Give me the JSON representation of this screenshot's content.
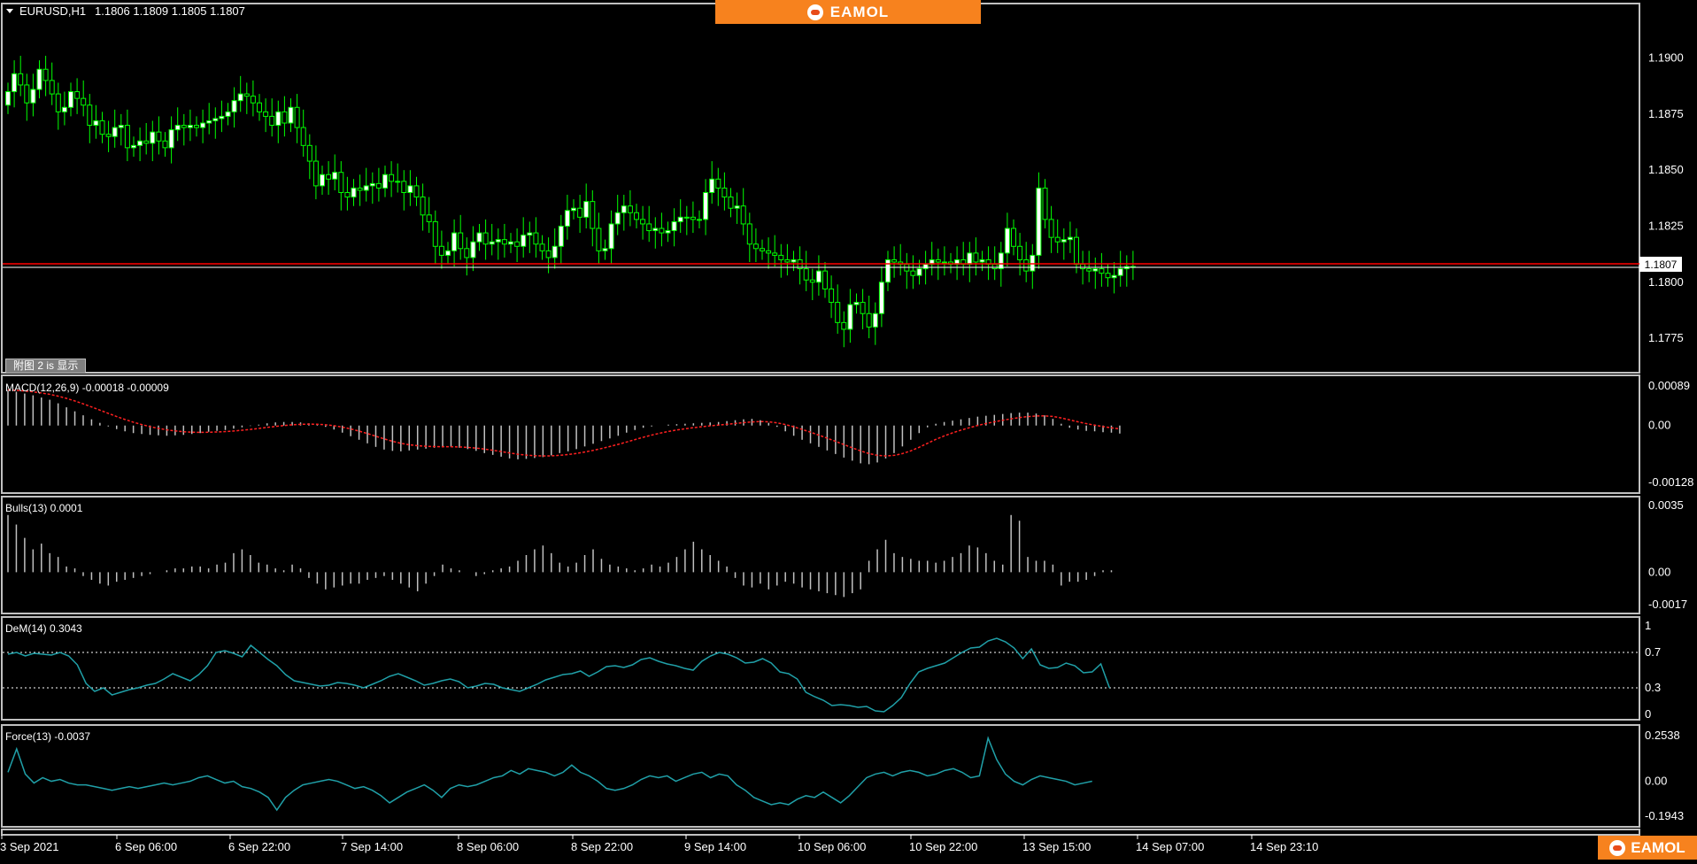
{
  "window": {
    "symbol_timeframe": "EURUSD,H1",
    "ohlc": "1.1806 1.1809 1.1805 1.1807",
    "current_price": "1.1807",
    "subwindow_tag": "附图 2 is 显示",
    "brand": "EAMOL"
  },
  "colors": {
    "background": "#000000",
    "grid_border": "#c0c0c0",
    "bull_candle": "#ffffff",
    "bear_candle": "#000000",
    "wick": "#00ff00",
    "ask_line": "#ff0000",
    "bid_line": "#ffffff",
    "macd_signal": "#ff2020",
    "indicator_line": "#20a0a8",
    "histogram": "#c0c0c0",
    "brand_orange": "#f7821e"
  },
  "panes": {
    "main": {
      "price_ticks": [
        "1.1900",
        "1.1875",
        "1.1850",
        "1.1825",
        "1.1800",
        "1.1775"
      ]
    },
    "macd": {
      "label": "MACD(12,26,9) -0.00018 -0.00009",
      "ticks": [
        "0.00089",
        "0.00",
        "-0.00128"
      ]
    },
    "bulls": {
      "label": "Bulls(13) 0.0001",
      "ticks": [
        "0.0035",
        "0.00",
        "-0.0017"
      ]
    },
    "dem": {
      "label": "DeM(14) 0.3043",
      "ticks": [
        "1",
        "0.7",
        "0.3",
        "0"
      ]
    },
    "force": {
      "label": "Force(13) -0.0037",
      "ticks": [
        "0.2538",
        "0.00",
        "-0.1943"
      ]
    }
  },
  "time_axis": [
    "3 Sep 2021",
    "6 Sep 06:00",
    "6 Sep 22:00",
    "7 Sep 14:00",
    "8 Sep 06:00",
    "8 Sep 22:00",
    "9 Sep 14:00",
    "10 Sep 06:00",
    "10 Sep 22:00",
    "13 Sep 15:00",
    "14 Sep 07:00",
    "14 Sep 23:10"
  ],
  "chart_data": [
    {
      "type": "candlestick",
      "title": "EURUSD,H1",
      "ylim": [
        1.1762,
        1.1918
      ],
      "close": [
        1.1885,
        1.1893,
        1.1888,
        1.188,
        1.1886,
        1.1895,
        1.189,
        1.1884,
        1.1876,
        1.1878,
        1.1885,
        1.1882,
        1.1879,
        1.187,
        1.1872,
        1.1866,
        1.1865,
        1.1869,
        1.187,
        1.186,
        1.1861,
        1.1863,
        1.1862,
        1.1867,
        1.1863,
        1.186,
        1.1868,
        1.187,
        1.1869,
        1.187,
        1.1869,
        1.1871,
        1.1872,
        1.1873,
        1.1874,
        1.1876,
        1.1881,
        1.1884,
        1.1883,
        1.188,
        1.1876,
        1.1874,
        1.187,
        1.1876,
        1.1871,
        1.1878,
        1.1869,
        1.1861,
        1.1854,
        1.1843,
        1.1848,
        1.1846,
        1.1849,
        1.184,
        1.1838,
        1.1842,
        1.1841,
        1.1843,
        1.1844,
        1.1842,
        1.1848,
        1.1845,
        1.1845,
        1.184,
        1.1843,
        1.1838,
        1.183,
        1.1827,
        1.1816,
        1.1812,
        1.1814,
        1.1822,
        1.1815,
        1.1811,
        1.1818,
        1.1822,
        1.1817,
        1.1818,
        1.1819,
        1.1817,
        1.1818,
        1.1816,
        1.1821,
        1.1822,
        1.1817,
        1.1814,
        1.1811,
        1.1816,
        1.1825,
        1.1832,
        1.1833,
        1.1829,
        1.1836,
        1.1824,
        1.1814,
        1.1815,
        1.1826,
        1.1831,
        1.1834,
        1.1831,
        1.1828,
        1.1826,
        1.1823,
        1.1824,
        1.1822,
        1.1823,
        1.1827,
        1.1829,
        1.1829,
        1.1828,
        1.1828,
        1.184,
        1.1846,
        1.1842,
        1.1838,
        1.1833,
        1.1834,
        1.1826,
        1.1817,
        1.1815,
        1.1814,
        1.1813,
        1.1812,
        1.181,
        1.1809,
        1.181,
        1.1806,
        1.1801,
        1.18,
        1.1805,
        1.1797,
        1.1791,
        1.1782,
        1.1779,
        1.179,
        1.1791,
        1.1786,
        1.178,
        1.1786,
        1.18,
        1.181,
        1.1809,
        1.1808,
        1.1805,
        1.1803,
        1.1806,
        1.1808,
        1.181,
        1.1809,
        1.1809,
        1.1808,
        1.181,
        1.1808,
        1.1813,
        1.1809,
        1.181,
        1.1808,
        1.1806,
        1.1813,
        1.1824,
        1.1816,
        1.181,
        1.1805,
        1.1812,
        1.1842,
        1.1828,
        1.182,
        1.1818,
        1.1819,
        1.182,
        1.1808,
        1.1806,
        1.1805,
        1.1806,
        1.1804,
        1.1802,
        1.1803,
        1.1806,
        1.1807,
        1.1807
      ]
    },
    {
      "type": "bar",
      "title": "MACD(12,26,9) -0.00018 -0.00009",
      "ylim": [
        -0.00128,
        0.00089
      ],
      "values": [
        0.0008,
        0.00076,
        0.00072,
        0.00068,
        0.00063,
        0.00058,
        0.0005,
        0.00041,
        0.00032,
        0.00023,
        0.00014,
        6e-05,
        -2e-05,
        -8e-05,
        -0.00013,
        -0.00017,
        -0.00019,
        -0.00021,
        -0.00022,
        -0.00023,
        -0.00022,
        -0.00021,
        -0.00019,
        -0.00017,
        -0.00014,
        -0.00012,
        -0.0001,
        -7e-05,
        -4e-05,
        -1e-05,
        2e-05,
        5e-05,
        7e-05,
        8e-05,
        8e-05,
        7e-05,
        5e-05,
        2e-05,
        -3e-05,
        -9e-05,
        -0.00016,
        -0.00024,
        -0.00032,
        -0.0004,
        -0.00048,
        -0.00054,
        -0.00057,
        -0.00058,
        -0.00056,
        -0.00054,
        -0.00052,
        -0.0005,
        -0.00049,
        -0.00048,
        -0.0005,
        -0.00053,
        -0.00057,
        -0.00062,
        -0.00066,
        -0.0007,
        -0.00074,
        -0.00076,
        -0.00075,
        -0.00073,
        -0.00071,
        -0.00067,
        -0.00062,
        -0.00058,
        -0.00053,
        -0.00047,
        -0.00041,
        -0.00035,
        -0.00029,
        -0.00023,
        -0.00016,
        -0.0001,
        -5e-05,
        -2e-05,
        0.0,
        2e-05,
        3e-05,
        4e-05,
        5e-05,
        6e-05,
        7e-05,
        8e-05,
        0.0001,
        0.00012,
        0.00014,
        0.00015,
        0.00012,
        6e-05,
        -3e-05,
        -0.00013,
        -0.00023,
        -0.00032,
        -0.0004,
        -0.00048,
        -0.00056,
        -0.00064,
        -0.00072,
        -0.00079,
        -0.00085,
        -0.00087,
        -0.00083,
        -0.00074,
        -0.00062,
        -0.00047,
        -0.00032,
        -0.00017,
        -4e-05,
        4e-05,
        8e-05,
        0.00011,
        0.00014,
        0.00017,
        0.0002,
        0.00022,
        0.00024,
        0.00026,
        0.00028,
        0.00029,
        0.00029,
        0.00027,
        0.00023,
        0.00015,
        4e-05,
        -5e-05,
        -9e-05,
        -0.00012,
        -0.00013,
        -0.00015,
        -0.00016,
        -0.00018
      ]
    },
    {
      "type": "bar",
      "title": "Bulls(13) 0.0001",
      "ylim": [
        -0.0017,
        0.0035
      ],
      "values": [
        0.003,
        0.0025,
        0.0018,
        0.0012,
        0.0015,
        0.001,
        0.0008,
        0.0003,
        0.0002,
        -0.0002,
        -0.0004,
        -0.0006,
        -0.0007,
        -0.0005,
        -0.0004,
        -0.0003,
        -0.0002,
        -0.0001,
        0.0,
        0.0001,
        0.0002,
        0.0002,
        0.0003,
        0.0003,
        0.0002,
        0.0004,
        0.0005,
        0.001,
        0.0012,
        0.0009,
        0.0005,
        0.0004,
        0.0002,
        0.0001,
        0.0004,
        0.0002,
        -0.0003,
        -0.0006,
        -0.0009,
        -0.0008,
        -0.0007,
        -0.0006,
        -0.0006,
        -0.0004,
        -0.0003,
        -0.0002,
        -0.0004,
        -0.0006,
        -0.0008,
        -0.001,
        -0.0006,
        -0.0002,
        0.0004,
        0.0002,
        0.0001,
        0.0,
        -0.0002,
        -0.0001,
        0.0001,
        0.0002,
        0.0003,
        0.0006,
        0.0009,
        0.0012,
        0.0014,
        0.001,
        0.0005,
        0.0003,
        0.0005,
        0.0009,
        0.0012,
        0.0007,
        0.0004,
        0.0003,
        0.0002,
        0.0001,
        0.0002,
        0.0004,
        0.0003,
        0.0005,
        0.0008,
        0.0012,
        0.0016,
        0.0012,
        0.0009,
        0.0006,
        0.0003,
        -0.0003,
        -0.0007,
        -0.0008,
        -0.0006,
        -0.0009,
        -0.0007,
        -0.0005,
        -0.0006,
        -0.0008,
        -0.0009,
        -0.001,
        -0.0011,
        -0.0012,
        -0.0013,
        -0.0011,
        -0.0009,
        0.0006,
        0.0012,
        0.0017,
        0.001,
        0.0008,
        0.0007,
        0.0006,
        0.0006,
        0.0005,
        0.0006,
        0.0008,
        0.001,
        0.0014,
        0.0013,
        0.001,
        0.0006,
        0.0004,
        0.003,
        0.0027,
        0.0008,
        0.0006,
        0.0006,
        0.0004,
        -0.0007,
        -0.0005,
        -0.0005,
        -0.0004,
        -0.0002,
        0.0001,
        0.0001
      ]
    },
    {
      "type": "line",
      "title": "DeM(14) 0.3043",
      "ylim": [
        0,
        1
      ],
      "values": [
        0.68,
        0.7,
        0.66,
        0.69,
        0.68,
        0.67,
        0.7,
        0.66,
        0.56,
        0.35,
        0.26,
        0.3,
        0.22,
        0.25,
        0.28,
        0.3,
        0.33,
        0.35,
        0.4,
        0.46,
        0.42,
        0.38,
        0.45,
        0.55,
        0.7,
        0.72,
        0.69,
        0.65,
        0.78,
        0.7,
        0.62,
        0.55,
        0.45,
        0.38,
        0.36,
        0.34,
        0.32,
        0.33,
        0.36,
        0.35,
        0.33,
        0.3,
        0.34,
        0.38,
        0.43,
        0.46,
        0.42,
        0.38,
        0.33,
        0.35,
        0.38,
        0.4,
        0.37,
        0.3,
        0.32,
        0.35,
        0.34,
        0.3,
        0.28,
        0.26,
        0.3,
        0.34,
        0.39,
        0.42,
        0.45,
        0.46,
        0.49,
        0.43,
        0.48,
        0.54,
        0.55,
        0.53,
        0.56,
        0.62,
        0.64,
        0.6,
        0.57,
        0.55,
        0.52,
        0.5,
        0.6,
        0.66,
        0.7,
        0.68,
        0.64,
        0.58,
        0.59,
        0.63,
        0.58,
        0.48,
        0.46,
        0.4,
        0.25,
        0.2,
        0.16,
        0.1,
        0.11,
        0.1,
        0.08,
        0.09,
        0.04,
        0.03,
        0.1,
        0.19,
        0.35,
        0.48,
        0.52,
        0.55,
        0.58,
        0.64,
        0.7,
        0.75,
        0.76,
        0.83,
        0.86,
        0.82,
        0.75,
        0.63,
        0.74,
        0.56,
        0.52,
        0.53,
        0.58,
        0.55,
        0.47,
        0.48,
        0.57,
        0.3
      ]
    },
    {
      "type": "line",
      "title": "Force(13) -0.0037",
      "ylim": [
        -0.1943,
        0.2538
      ],
      "values": [
        0.05,
        0.18,
        0.04,
        -0.01,
        0.02,
        0.0,
        0.01,
        -0.01,
        -0.02,
        -0.02,
        -0.03,
        -0.04,
        -0.05,
        -0.04,
        -0.03,
        -0.04,
        -0.03,
        -0.02,
        -0.01,
        -0.02,
        -0.01,
        0.0,
        0.02,
        0.03,
        0.01,
        -0.01,
        0.0,
        -0.03,
        -0.04,
        -0.06,
        -0.09,
        -0.16,
        -0.09,
        -0.05,
        -0.02,
        -0.01,
        0.0,
        0.01,
        0.0,
        -0.02,
        -0.04,
        -0.03,
        -0.05,
        -0.08,
        -0.12,
        -0.09,
        -0.06,
        -0.04,
        -0.02,
        -0.05,
        -0.09,
        -0.04,
        -0.02,
        -0.03,
        -0.02,
        0.0,
        0.02,
        0.03,
        0.06,
        0.04,
        0.07,
        0.06,
        0.05,
        0.03,
        0.05,
        0.09,
        0.05,
        0.03,
        0.0,
        -0.04,
        -0.05,
        -0.04,
        -0.02,
        0.01,
        0.03,
        0.02,
        0.03,
        0.0,
        0.02,
        0.04,
        0.05,
        0.02,
        0.04,
        0.03,
        -0.02,
        -0.05,
        -0.09,
        -0.11,
        -0.13,
        -0.12,
        -0.13,
        -0.1,
        -0.08,
        -0.09,
        -0.06,
        -0.09,
        -0.12,
        -0.08,
        -0.03,
        0.02,
        0.04,
        0.05,
        0.03,
        0.05,
        0.06,
        0.05,
        0.03,
        0.04,
        0.06,
        0.07,
        0.05,
        0.02,
        0.03,
        0.24,
        0.12,
        0.04,
        0.0,
        -0.02,
        0.01,
        0.03,
        0.02,
        0.01,
        0.0,
        -0.02,
        -0.01,
        0.0
      ]
    }
  ]
}
